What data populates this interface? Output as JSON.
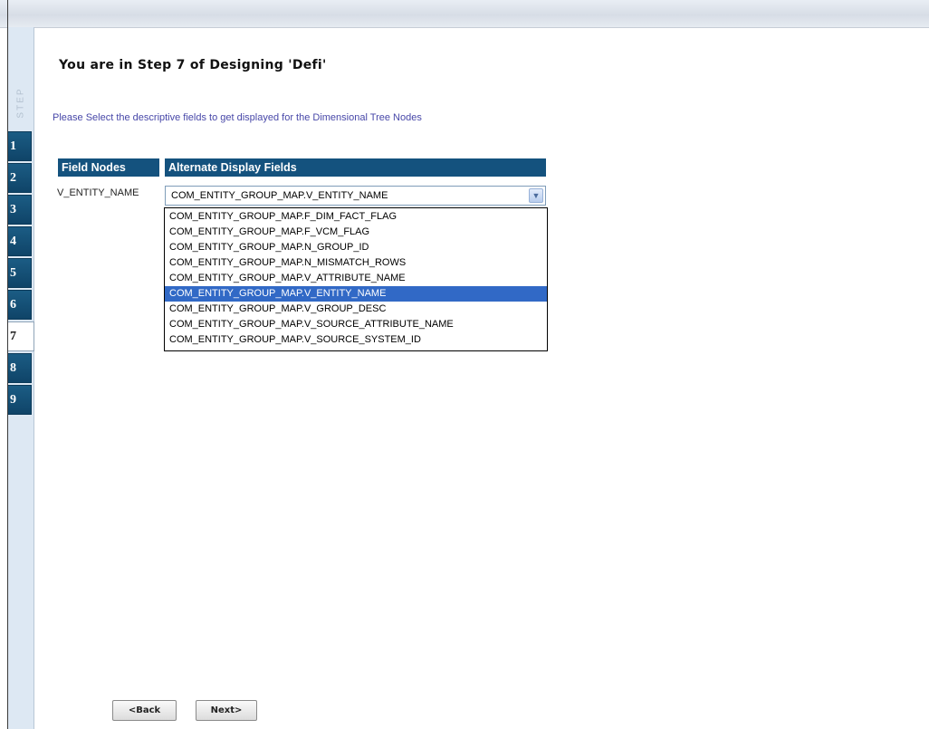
{
  "wizard": {
    "step_label": "STEP",
    "steps": [
      "1",
      "2",
      "3",
      "4",
      "5",
      "6",
      "7",
      "8",
      "9"
    ],
    "active_step": "7"
  },
  "page": {
    "title": "You are in Step 7 of Designing 'Defi'",
    "instruction": "Please Select the descriptive fields to get displayed for the Dimensional Tree Nodes"
  },
  "table": {
    "header_field_nodes": "Field Nodes",
    "header_alternate_display": "Alternate Display Fields",
    "row": {
      "field_node": "V_ENTITY_NAME",
      "selected_value": "COM_ENTITY_GROUP_MAP.V_ENTITY_NAME"
    }
  },
  "dropdown": {
    "options": [
      "COM_ENTITY_GROUP_MAP.F_DIM_FACT_FLAG",
      "COM_ENTITY_GROUP_MAP.F_VCM_FLAG",
      "COM_ENTITY_GROUP_MAP.N_GROUP_ID",
      "COM_ENTITY_GROUP_MAP.N_MISMATCH_ROWS",
      "COM_ENTITY_GROUP_MAP.V_ATTRIBUTE_NAME",
      "COM_ENTITY_GROUP_MAP.V_ENTITY_NAME",
      "COM_ENTITY_GROUP_MAP.V_GROUP_DESC",
      "COM_ENTITY_GROUP_MAP.V_SOURCE_ATTRIBUTE_NAME",
      "COM_ENTITY_GROUP_MAP.V_SOURCE_SYSTEM_ID"
    ],
    "highlighted": "COM_ENTITY_GROUP_MAP.V_ENTITY_NAME"
  },
  "buttons": {
    "back_label": "<Back",
    "next_label": "Next>"
  },
  "icons": {
    "dropdown_arrow": "chevron-down-icon"
  },
  "colors": {
    "header_bg": "#14527e",
    "step_tab_bg": "#0f4468",
    "instruction_text": "#4747a8",
    "selected_option_bg": "#3169c6"
  }
}
